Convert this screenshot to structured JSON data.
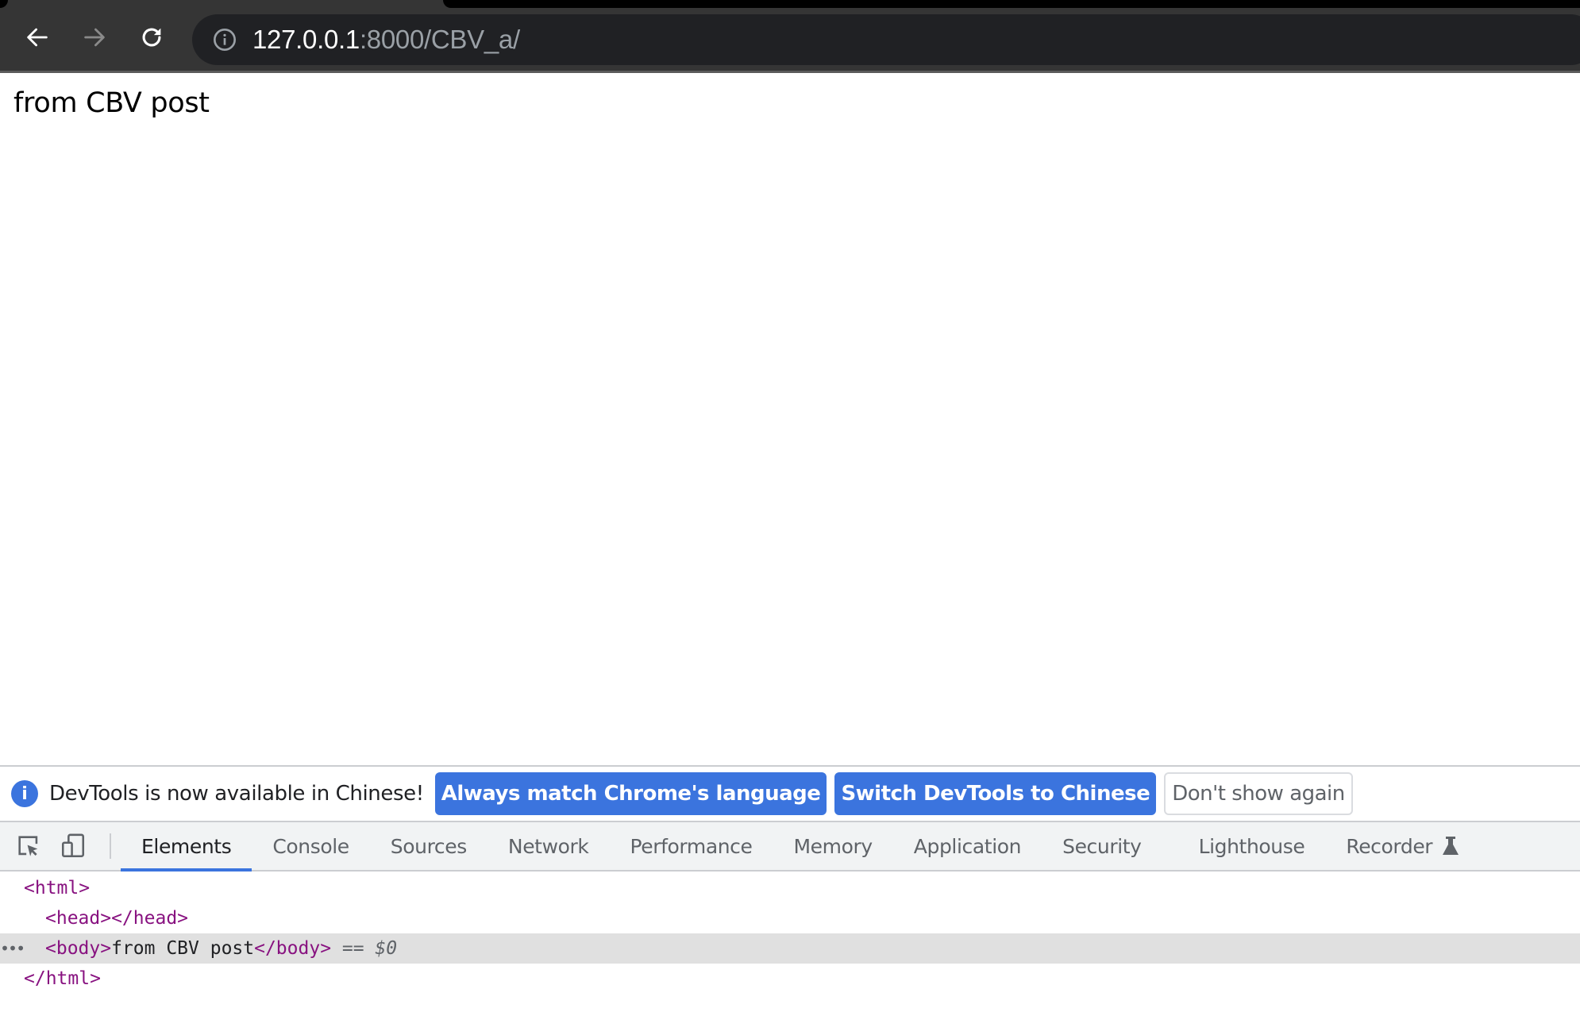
{
  "browser": {
    "nav": {
      "back_icon": "arrow-left-icon",
      "forward_icon": "arrow-right-icon",
      "reload_icon": "reload-icon"
    },
    "omnibox": {
      "site_info_icon": "info-circle-icon",
      "url_host": "127.0.0.1",
      "url_rest": ":8000/CBV_a/"
    }
  },
  "page": {
    "body_text": "from CBV post"
  },
  "devtools": {
    "infobar": {
      "icon": "info-icon",
      "icon_glyph": "i",
      "message": "DevTools is now available in Chinese!",
      "buttons": [
        {
          "label": "Always match Chrome's language",
          "style": "primary"
        },
        {
          "label": "Switch DevTools to Chinese",
          "style": "primary"
        },
        {
          "label": "Don't show again",
          "style": "secondary"
        }
      ]
    },
    "toolbar": {
      "inspect_icon": "inspect-element-icon",
      "device_icon": "device-toolbar-icon"
    },
    "tabs": [
      {
        "label": "Elements",
        "active": true
      },
      {
        "label": "Console",
        "active": false
      },
      {
        "label": "Sources",
        "active": false
      },
      {
        "label": "Network",
        "active": false
      },
      {
        "label": "Performance",
        "active": false
      },
      {
        "label": "Memory",
        "active": false
      },
      {
        "label": "Application",
        "active": false
      },
      {
        "label": "Security",
        "active": false
      },
      {
        "label": "Lighthouse",
        "active": false
      },
      {
        "label": "Recorder",
        "active": false,
        "badge_icon": "experimental-flask-icon"
      }
    ],
    "dom_tree": {
      "html_open": "<html>",
      "head": "<head></head>",
      "body_open": "<body>",
      "body_text": "from CBV post",
      "body_close": "</body>",
      "selected_marker": " == $0",
      "ellipsis": "•••",
      "html_close": "</html>"
    }
  },
  "colors": {
    "accent": "#3b74de",
    "tag": "#881280",
    "chrome_bg": "#353535",
    "omnibox_bg": "#202124",
    "selected_row": "#e0e0e0"
  }
}
